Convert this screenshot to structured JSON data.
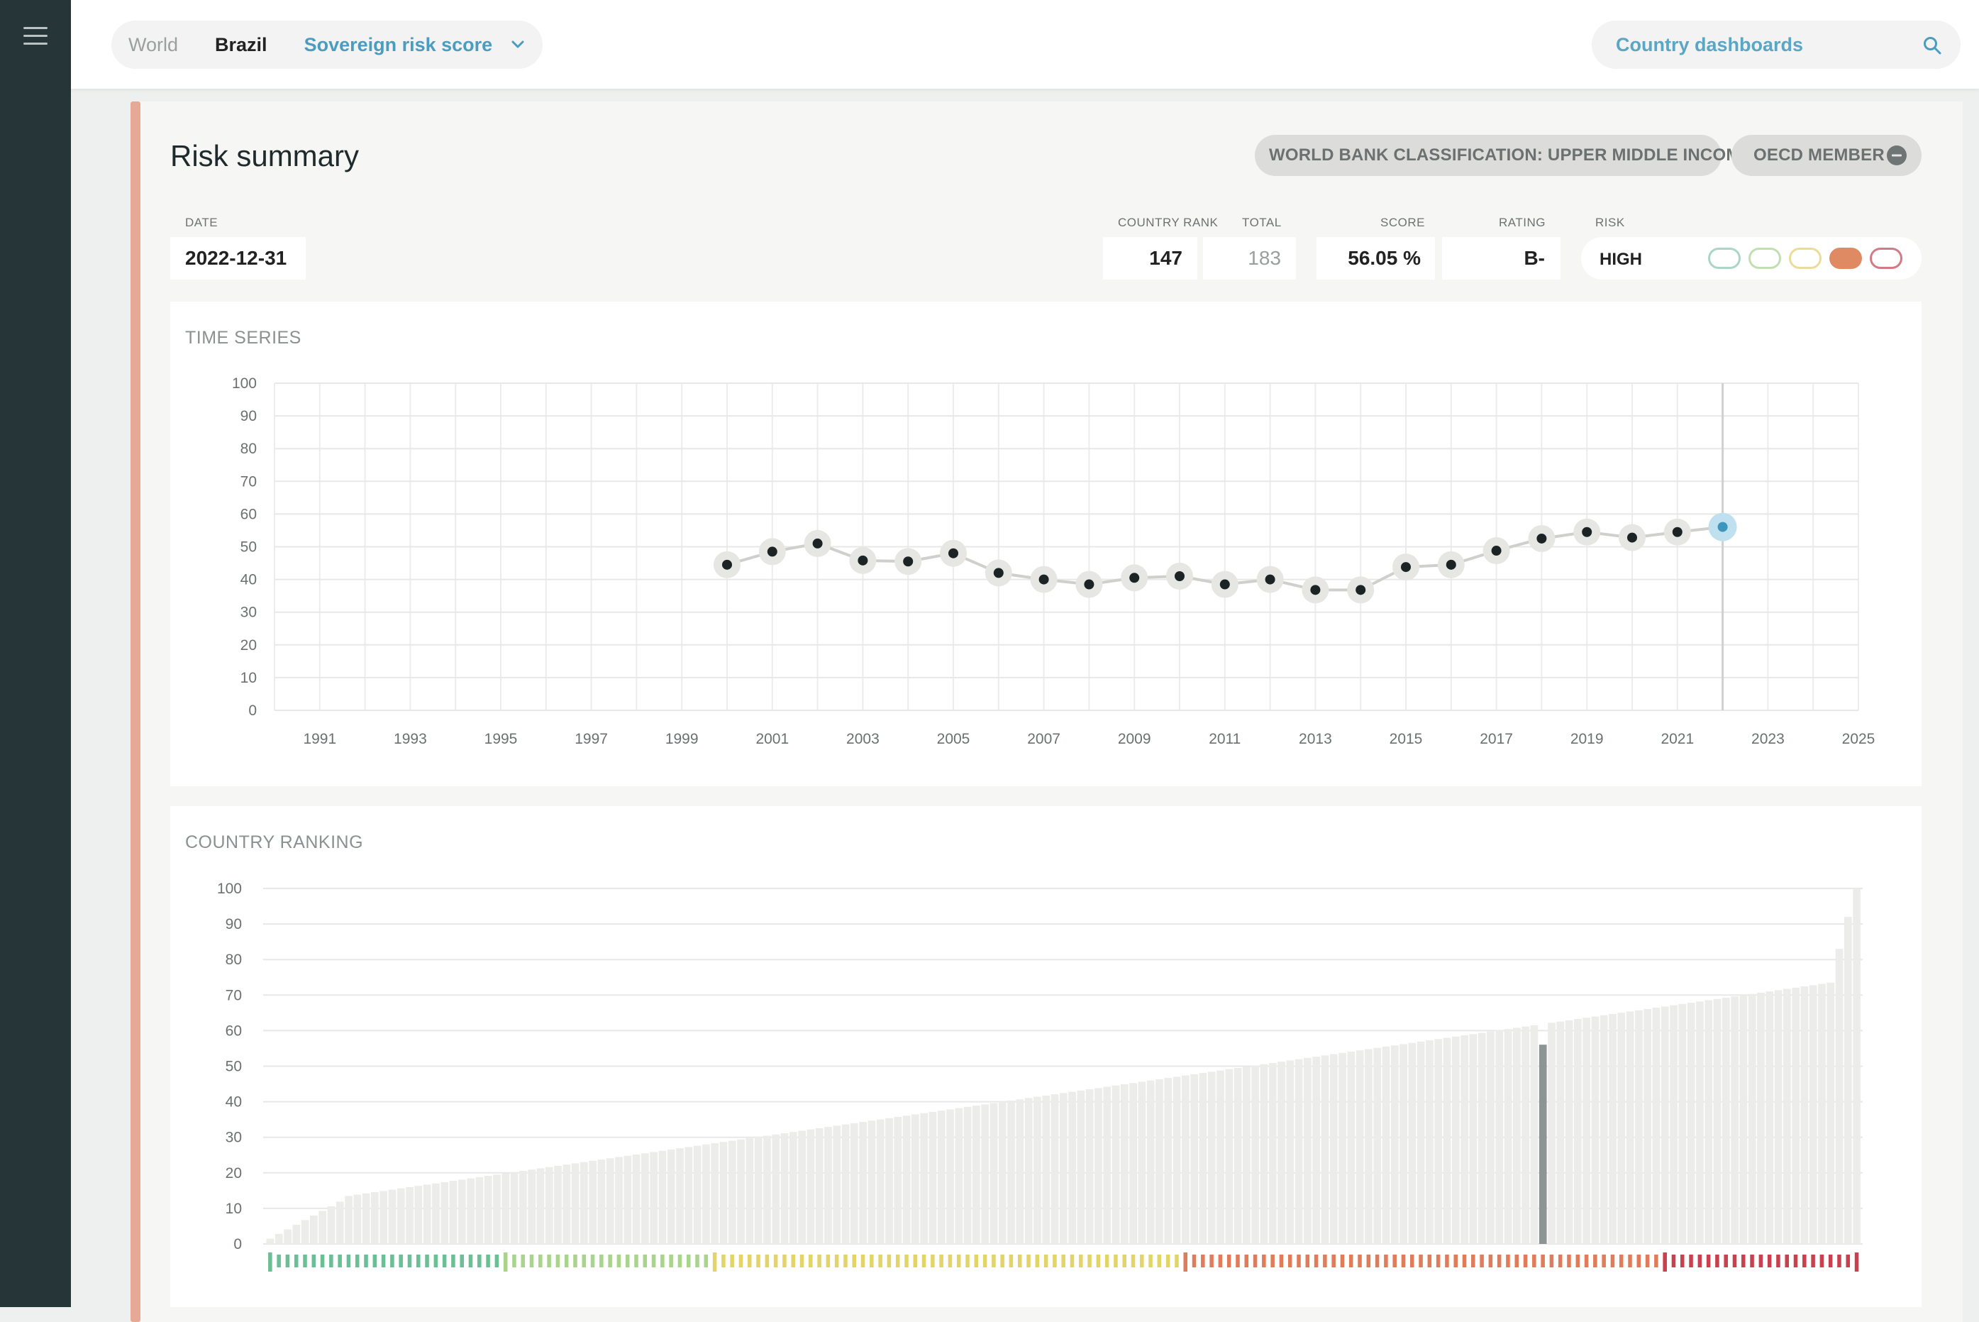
{
  "breadcrumb": {
    "world": "World",
    "country": "Brazil",
    "indicator": "Sovereign risk score"
  },
  "search": {
    "placeholder": "Country dashboards"
  },
  "summary": {
    "title": "Risk summary",
    "classification": "WORLD BANK CLASSIFICATION: UPPER MIDDLE INCOME",
    "oecd": "OECD MEMBER",
    "date_label": "DATE",
    "date": "2022-12-31",
    "rank_label": "COUNTRY RANK",
    "rank": "147",
    "total_label": "TOTAL",
    "total": "183",
    "score_label": "SCORE",
    "score": "56.05 %",
    "rating_label": "RATING",
    "rating": "B-",
    "risk_label": "RISK",
    "risk": "HIGH",
    "risk_scale": [
      {
        "level": "very-low",
        "color": "#a9d6c9",
        "active": false
      },
      {
        "level": "low",
        "color": "#c2dfb1",
        "active": false
      },
      {
        "level": "medium",
        "color": "#ecdc9a",
        "active": false
      },
      {
        "level": "high",
        "color": "#e08a64",
        "active": true
      },
      {
        "level": "very-high",
        "color": "#d27b86",
        "active": false
      }
    ]
  },
  "time_series": {
    "title": "TIME SERIES",
    "chart_data": {
      "type": "line",
      "x": [
        2000,
        2001,
        2002,
        2003,
        2004,
        2005,
        2006,
        2007,
        2008,
        2009,
        2010,
        2011,
        2012,
        2013,
        2014,
        2015,
        2016,
        2017,
        2018,
        2019,
        2020,
        2021,
        2022
      ],
      "y": [
        44.5,
        48.5,
        51,
        45.8,
        45.5,
        48,
        42,
        40,
        38.5,
        40.5,
        41,
        38.5,
        40,
        36.8,
        36.8,
        43.8,
        44.5,
        48.8,
        52.5,
        54.5,
        52.8,
        54.5,
        56.05
      ],
      "highlight_x": 2022,
      "xlim": [
        1990,
        2025
      ],
      "ylim": [
        0,
        100
      ],
      "xticks": [
        "1991",
        "1993",
        "1995",
        "1997",
        "1999",
        "2001",
        "2003",
        "2005",
        "2007",
        "2009",
        "2011",
        "2013",
        "2015",
        "2017",
        "2019",
        "2021",
        "2023",
        "2025"
      ],
      "yticks": [
        "0",
        "10",
        "20",
        "30",
        "40",
        "50",
        "60",
        "70",
        "80",
        "90",
        "100"
      ],
      "grid": true
    }
  },
  "ranking": {
    "title": "COUNTRY RANKING",
    "chart_data": {
      "type": "bar",
      "count": 183,
      "highlight_rank": 147,
      "min": 1.5,
      "max": 100,
      "band_edges": [
        27,
        51,
        105,
        160
      ],
      "band_colors": [
        "#6bbf95",
        "#a8d48c",
        "#e3d46a",
        "#e07c5a",
        "#c9404e"
      ],
      "ylim": [
        0,
        100
      ],
      "yticks": [
        "0",
        "10",
        "20",
        "30",
        "40",
        "50",
        "60",
        "70",
        "80",
        "90",
        "100"
      ],
      "grid": true
    }
  }
}
